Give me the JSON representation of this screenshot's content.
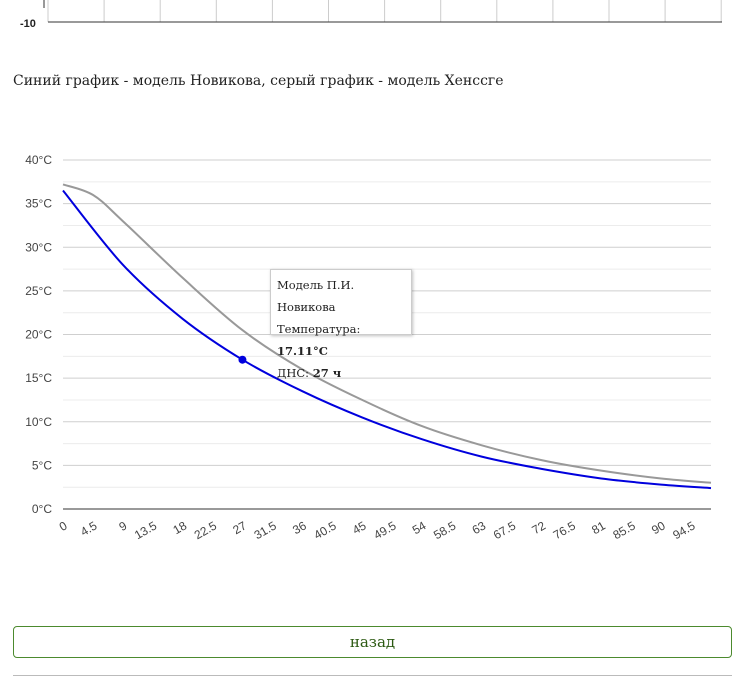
{
  "prev_chart": {
    "visible_tick": "-10"
  },
  "caption": "Синий график - модель Новикова, серый график - модель Хенссге",
  "tooltip": {
    "title": "Модель П.И. Новикова",
    "temp_label": "Температура: ",
    "temp_value": "17.11°C",
    "time_label": "ДНС: ",
    "time_value": "27 ч"
  },
  "back_button": "назад",
  "chart_data": {
    "type": "line",
    "x_ticks": [
      "0",
      "4.5",
      "9",
      "13.5",
      "18",
      "22.5",
      "27",
      "31.5",
      "36",
      "40.5",
      "45",
      "49.5",
      "54",
      "58.5",
      "63",
      "67.5",
      "72",
      "76.5",
      "81",
      "85.5",
      "90",
      "94.5"
    ],
    "y_ticks": [
      "0°C",
      "5°C",
      "10°C",
      "15°C",
      "20°C",
      "25°C",
      "30°C",
      "35°C",
      "40°C"
    ],
    "xlim": [
      0,
      97.5
    ],
    "ylim": [
      0,
      40
    ],
    "grid": true,
    "series": [
      {
        "color": "#0000dd",
        "x": [
          0,
          9,
          18,
          27,
          36,
          45,
          54,
          63,
          72,
          81,
          90,
          97.5
        ],
        "y": [
          36.5,
          28.0,
          21.8,
          17.11,
          13.5,
          10.5,
          8.0,
          6.0,
          4.6,
          3.5,
          2.8,
          2.4
        ]
      },
      {
        "color": "#999999",
        "x": [
          0,
          4.5,
          9,
          18,
          27,
          36,
          45,
          54,
          63,
          72,
          81,
          90,
          97.5
        ],
        "y": [
          37.2,
          36.0,
          33.0,
          26.5,
          20.5,
          16.0,
          12.5,
          9.5,
          7.3,
          5.6,
          4.4,
          3.5,
          3.0
        ]
      }
    ],
    "highlight": {
      "series": 0,
      "x": 27,
      "y": 17.11
    }
  },
  "colors": {
    "blue_series": "#0000dd",
    "gray_series": "#999999",
    "button_border": "#4c8a2e",
    "button_text": "#2c5a12"
  }
}
